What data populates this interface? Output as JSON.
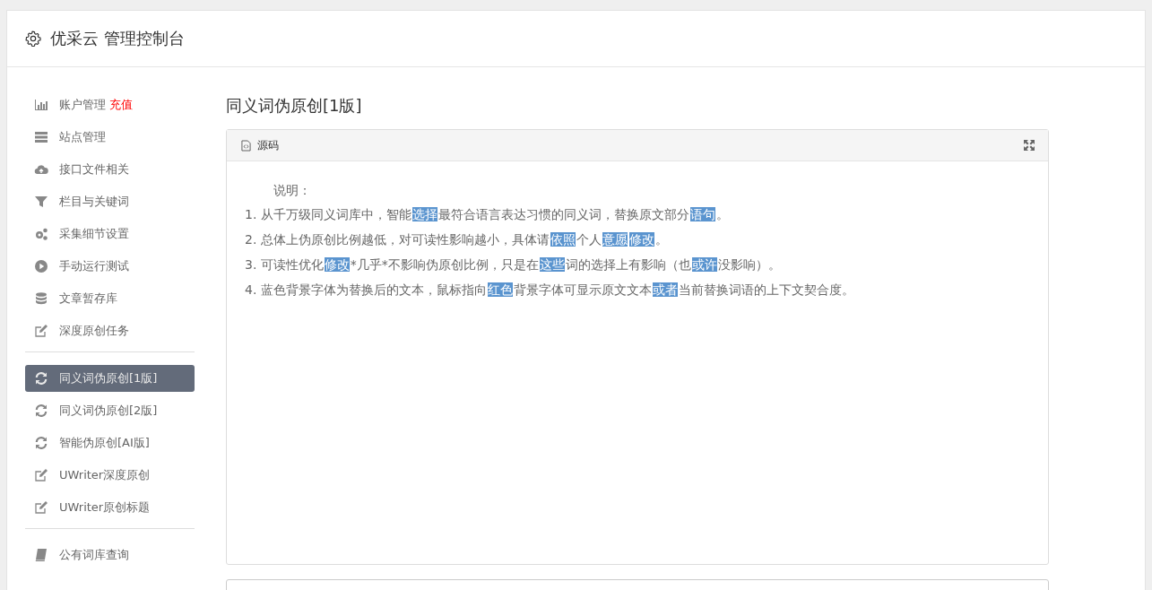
{
  "header": {
    "title": "优采云 管理控制台"
  },
  "sidebar": {
    "groups": [
      {
        "items": [
          {
            "label": "账户管理",
            "badge": "充值",
            "selected": false
          },
          {
            "label": "站点管理",
            "selected": false
          },
          {
            "label": "接口文件相关",
            "selected": false
          },
          {
            "label": "栏目与关键词",
            "selected": false
          },
          {
            "label": "采集细节设置",
            "selected": false
          },
          {
            "label": "手动运行测试",
            "selected": false
          },
          {
            "label": "文章暂存库",
            "selected": false
          },
          {
            "label": "深度原创任务",
            "selected": false
          }
        ]
      },
      {
        "items": [
          {
            "label": "同义词伪原创[1版]",
            "selected": true
          },
          {
            "label": "同义词伪原创[2版]",
            "selected": false
          },
          {
            "label": "智能伪原创[AI版]",
            "selected": false
          },
          {
            "label": "UWriter深度原创",
            "selected": false
          },
          {
            "label": "UWriter原创标题",
            "selected": false
          }
        ]
      },
      {
        "items": [
          {
            "label": "公有词库查询",
            "selected": false
          }
        ]
      }
    ]
  },
  "main": {
    "title": "同义词伪原创[1版]",
    "panel": {
      "title": "源码",
      "intro": "说明：",
      "lines": [
        [
          {
            "text": "1. 从千万级同义词库中，智能",
            "highlight": false
          },
          {
            "text": "选择",
            "highlight": true
          },
          {
            "text": "最符合语言表达习惯的同义词，替换原文部分",
            "highlight": false
          },
          {
            "text": "语句",
            "highlight": true
          },
          {
            "text": "。",
            "highlight": false
          }
        ],
        [
          {
            "text": "2. 总体上伪原创比例越低，对可读性影响越小，具体请",
            "highlight": false
          },
          {
            "text": "依照",
            "highlight": true
          },
          {
            "text": "个人",
            "highlight": false
          },
          {
            "text": "意愿",
            "highlight": true
          },
          {
            "text": "修改",
            "highlight": true
          },
          {
            "text": "。",
            "highlight": false
          }
        ],
        [
          {
            "text": "3. 可读性优化",
            "highlight": false
          },
          {
            "text": "修改",
            "highlight": true
          },
          {
            "text": "*几乎*不影响伪原创比例，只是在",
            "highlight": false
          },
          {
            "text": "这些",
            "highlight": true
          },
          {
            "text": "词的选择上有影响（也",
            "highlight": false
          },
          {
            "text": "或许",
            "highlight": true
          },
          {
            "text": "没影响）。",
            "highlight": false
          }
        ],
        [
          {
            "text": "4. 蓝色背景字体为替换后的文本，鼠标指向",
            "highlight": false
          },
          {
            "text": "红色",
            "highlight": true
          },
          {
            "text": "背景字体可显示原文文本",
            "highlight": false
          },
          {
            "text": "或者",
            "highlight": true
          },
          {
            "text": "当前替换词语的上下文契合度。",
            "highlight": false
          }
        ]
      ]
    }
  }
}
